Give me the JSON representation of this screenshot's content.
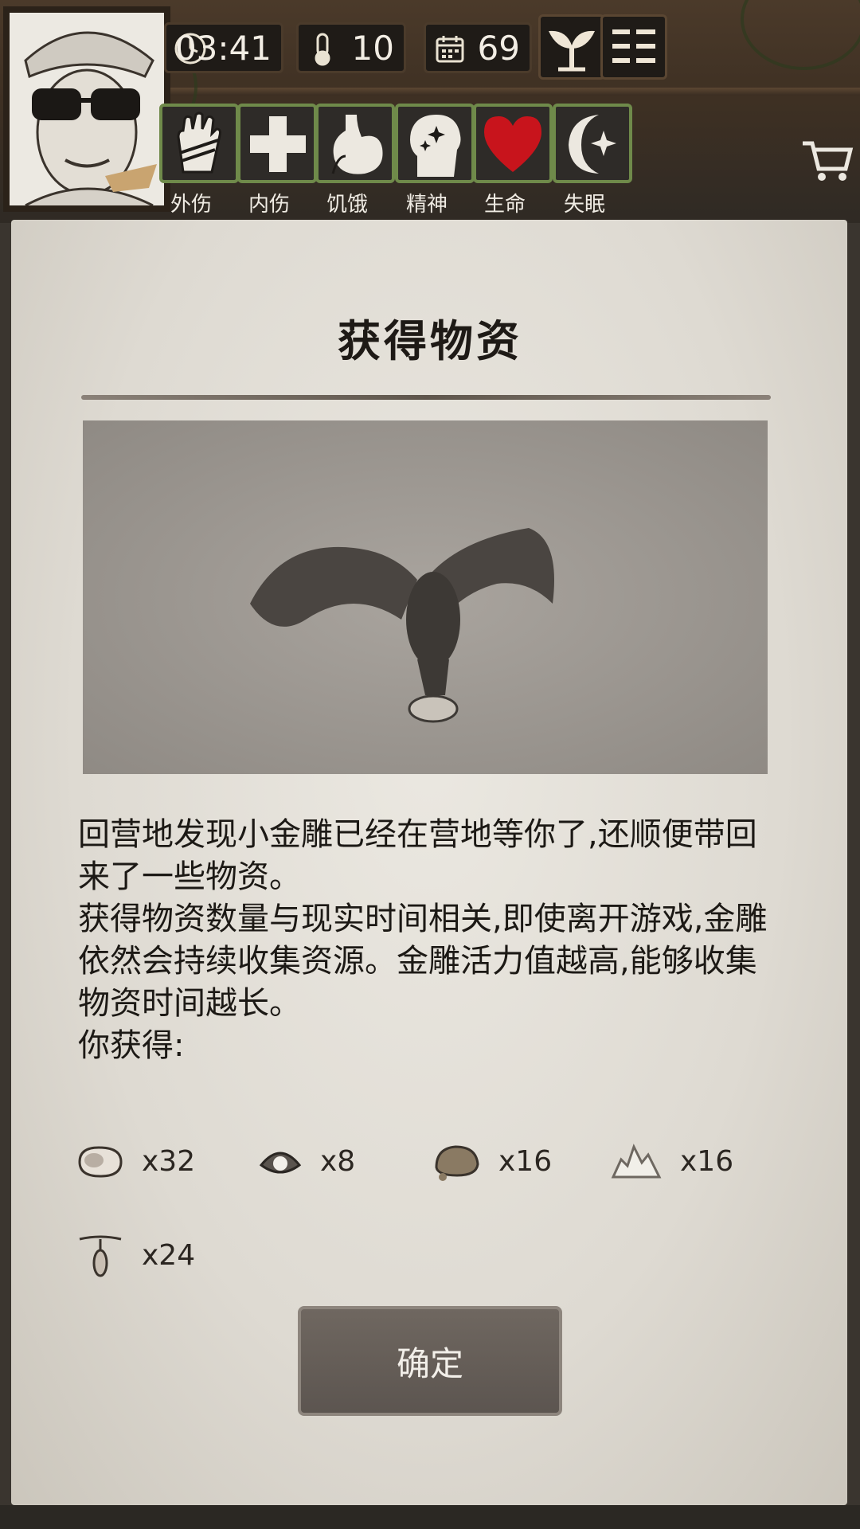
{
  "status_bar": {
    "time": "03:41",
    "temperature": "10",
    "day": "69"
  },
  "stats": [
    {
      "label": "外伤",
      "icon": "hand-bandage-icon"
    },
    {
      "label": "内伤",
      "icon": "cross-icon"
    },
    {
      "label": "饥饿",
      "icon": "stomach-icon"
    },
    {
      "label": "精神",
      "icon": "head-sparkle-icon"
    },
    {
      "label": "生命",
      "icon": "heart-icon"
    },
    {
      "label": "失眠",
      "icon": "moon-star-icon"
    }
  ],
  "dialog": {
    "title": "获得物资",
    "paragraphs": [
      "回营地发现小金雕已经在营地等你了,还顺便带回来了一些物资。",
      "获得物资数量与现实时间相关,即使离开游戏,金雕依然会持续收集资源。金雕活力值越高,能够收集物资时间越长。",
      "你获得:"
    ],
    "items": [
      {
        "icon": "meat-icon",
        "count": "x32"
      },
      {
        "icon": "pearl-shell-icon",
        "count": "x8"
      },
      {
        "icon": "stone-icon",
        "count": "x16"
      },
      {
        "icon": "crystal-icon",
        "count": "x16"
      },
      {
        "icon": "root-icon",
        "count": "x24"
      }
    ],
    "confirm_label": "确定"
  },
  "colors": {
    "paper": "#e6e3dc",
    "stat_border": "#6f8a4a",
    "heart": "#c8141c",
    "button": "#645d57"
  }
}
